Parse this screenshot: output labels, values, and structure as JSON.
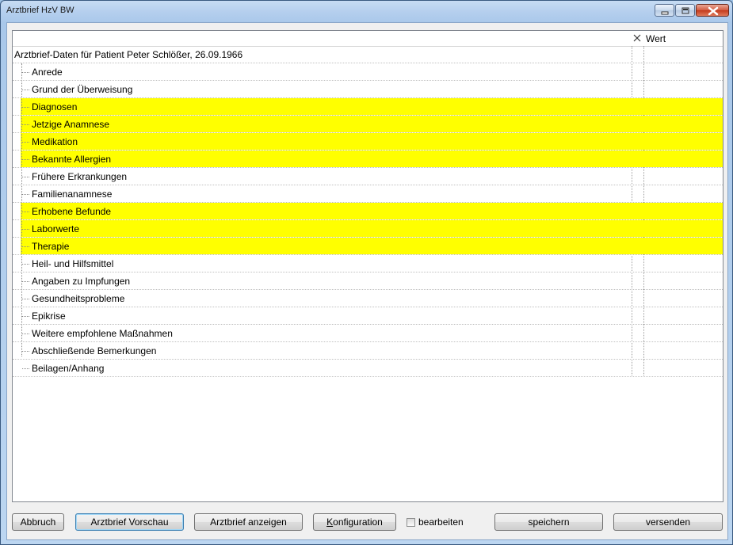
{
  "window": {
    "title": "Arztbrief HzV BW"
  },
  "grid": {
    "header_value": "Wert",
    "root_label": "Arztbrief-Daten für Patient Peter Schlößer, 26.09.1966",
    "items": [
      {
        "label": "Anrede",
        "highlighted": false
      },
      {
        "label": "Grund der Überweisung",
        "highlighted": false
      },
      {
        "label": "Diagnosen",
        "highlighted": true
      },
      {
        "label": "Jetzige Anamnese",
        "highlighted": true
      },
      {
        "label": "Medikation",
        "highlighted": true
      },
      {
        "label": "Bekannte Allergien",
        "highlighted": true
      },
      {
        "label": "Frühere Erkrankungen",
        "highlighted": false
      },
      {
        "label": "Familienanamnese",
        "highlighted": false
      },
      {
        "label": "Erhobene Befunde",
        "highlighted": true
      },
      {
        "label": "Laborwerte",
        "highlighted": true
      },
      {
        "label": "Therapie",
        "highlighted": true
      },
      {
        "label": "Heil- und Hilfsmittel",
        "highlighted": false
      },
      {
        "label": "Angaben zu Impfungen",
        "highlighted": false
      },
      {
        "label": "Gesundheitsprobleme",
        "highlighted": false
      },
      {
        "label": "Epikrise",
        "highlighted": false
      },
      {
        "label": "Weitere empfohlene Maßnahmen",
        "highlighted": false
      },
      {
        "label": "Abschließende Bemerkungen",
        "highlighted": false
      },
      {
        "label": "Beilagen/Anhang",
        "highlighted": false
      }
    ],
    "highlight_color": "#ffff00"
  },
  "buttons": {
    "abbruch": "Abbruch",
    "vorschau": "Arztbrief Vorschau",
    "anzeigen": "Arztbrief anzeigen",
    "konfiguration": "Konfiguration",
    "speichern": "speichern",
    "versenden": "versenden"
  },
  "checkbox": {
    "label": "bearbeiten",
    "checked": false
  }
}
